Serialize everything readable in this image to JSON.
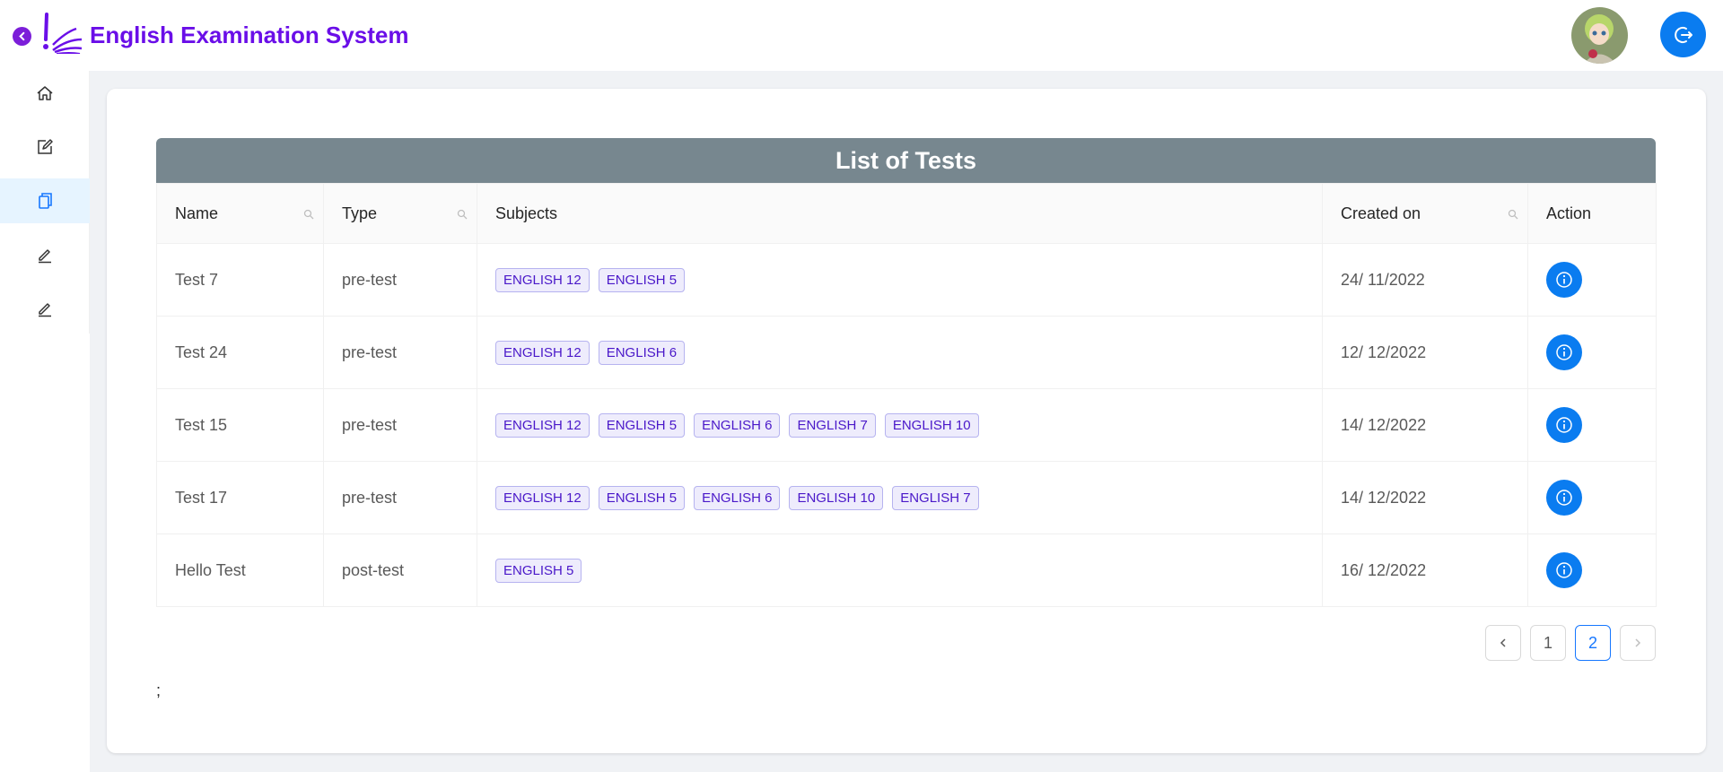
{
  "header": {
    "title": "English Examination System"
  },
  "sidebar": {
    "items": [
      {
        "name": "home",
        "icon": "home-icon"
      },
      {
        "name": "edit",
        "icon": "edit-square-icon"
      },
      {
        "name": "tests",
        "icon": "copy-icon",
        "active": true
      },
      {
        "name": "pen-1",
        "icon": "pen-icon"
      },
      {
        "name": "pen-2",
        "icon": "pen-icon"
      }
    ]
  },
  "table": {
    "title": "List of Tests",
    "columns": {
      "name": "Name",
      "type": "Type",
      "subjects": "Subjects",
      "created": "Created on",
      "action": "Action"
    },
    "rows": [
      {
        "name": "Test 7",
        "type": "pre-test",
        "subjects": [
          "ENGLISH 12",
          "ENGLISH 5"
        ],
        "created": "24/ 11/2022"
      },
      {
        "name": "Test 24",
        "type": "pre-test",
        "subjects": [
          "ENGLISH 12",
          "ENGLISH 6"
        ],
        "created": "12/ 12/2022"
      },
      {
        "name": "Test 15",
        "type": "pre-test",
        "subjects": [
          "ENGLISH 12",
          "ENGLISH 5",
          "ENGLISH 6",
          "ENGLISH 7",
          "ENGLISH 10"
        ],
        "created": "14/ 12/2022"
      },
      {
        "name": "Test 17",
        "type": "pre-test",
        "subjects": [
          "ENGLISH 12",
          "ENGLISH 5",
          "ENGLISH 6",
          "ENGLISH 10",
          "ENGLISH 7"
        ],
        "created": "14/ 12/2022"
      },
      {
        "name": "Hello Test",
        "type": "post-test",
        "subjects": [
          "ENGLISH 5"
        ],
        "created": "16/ 12/2022"
      }
    ]
  },
  "pagination": {
    "pages": [
      "1",
      "2"
    ],
    "current": "2"
  },
  "footer_text": ";",
  "colors": {
    "brand": "#6a0ee8",
    "primary": "#0a7cf0",
    "title_bar": "#77878f"
  }
}
